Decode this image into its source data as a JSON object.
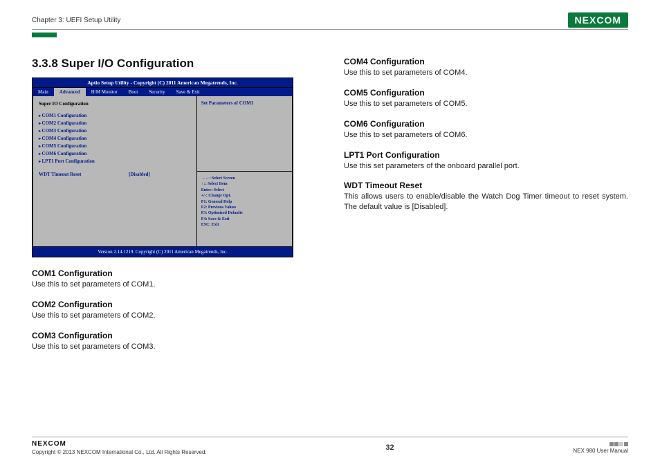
{
  "header": {
    "chapter": "Chapter 3: UEFI Setup Utility",
    "logo_text": "NEXCOM"
  },
  "section": {
    "number_title": "3.3.8  Super I/O Configuration"
  },
  "bios": {
    "title": "Aptio Setup Utility - Copyright (C) 2011 American Megatrends, Inc.",
    "tabs": [
      "Main",
      "Advanced",
      "H/M Monitor",
      "Boot",
      "Security",
      "Save & Exit"
    ],
    "selected_tab": "Advanced",
    "panel_header": "Super IO Configuration",
    "menu_items": [
      "COM1 Configuration",
      "COM2 Configuration",
      "COM3 Configuration",
      "COM4 Configuration",
      "COM5 Configuration",
      "COM6 Configuration",
      "LPT1 Port Configuration"
    ],
    "wdt_label": "WDT Timeout Reset",
    "wdt_value": "[Disabled]",
    "help_top": "Set Parameters of COM1",
    "help_keys": [
      "→←: Select Screen",
      "↑↓: Select Item",
      "Enter: Select",
      "+/-: Change Opt.",
      "F1: General Help",
      "F2: Previous Values",
      "F3: Optimized Defaults",
      "F4: Save & Exit",
      "ESC: Exit"
    ],
    "footer": "Version 2.14.1219. Copyright (C) 2011 American Megatrends, Inc."
  },
  "descriptions_left": [
    {
      "title": "COM1 Configuration",
      "body": "Use this to set parameters of COM1."
    },
    {
      "title": "COM2 Configuration",
      "body": "Use this to set parameters of COM2."
    },
    {
      "title": "COM3 Configuration",
      "body": "Use this to set parameters of COM3."
    }
  ],
  "descriptions_right": [
    {
      "title": "COM4 Configuration",
      "body": "Use this to set parameters of COM4."
    },
    {
      "title": "COM5 Configuration",
      "body": "Use this to set parameters of COM5."
    },
    {
      "title": "COM6 Configuration",
      "body": "Use this to set parameters of COM6."
    },
    {
      "title": "LPT1 Port Configuration",
      "body": "Use this set parameters of the onboard parallel port."
    },
    {
      "title": "WDT Timeout Reset",
      "body": "This allows users to enable/disable the Watch Dog Timer timeout to reset system. The default value is [Disabled]."
    }
  ],
  "footer": {
    "logo": "NEXCOM",
    "copyright": "Copyright © 2013 NEXCOM International Co., Ltd. All Rights Reserved.",
    "page": "32",
    "manual": "NEX 980 User Manual"
  }
}
